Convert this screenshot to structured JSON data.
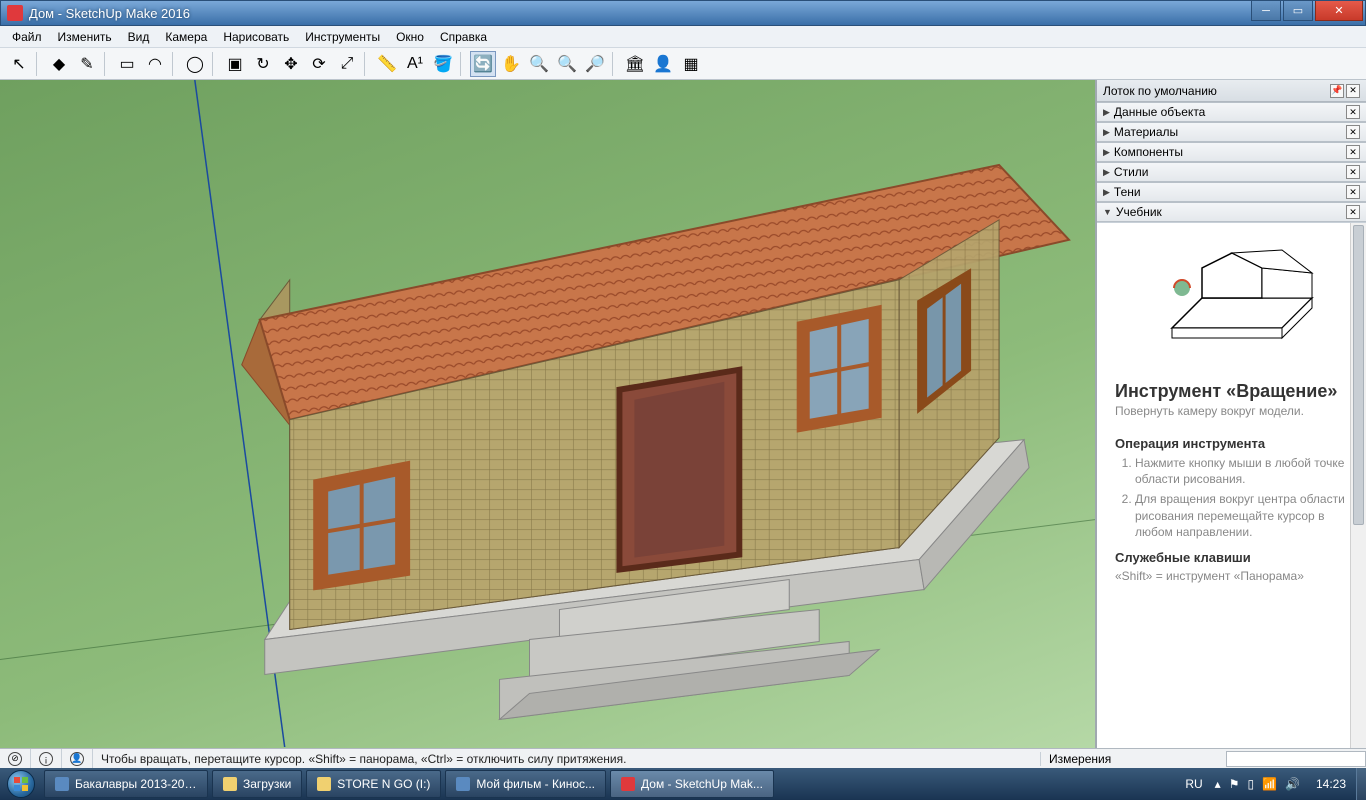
{
  "title": "Дом - SketchUp Make 2016",
  "menu": [
    "Файл",
    "Изменить",
    "Вид",
    "Камера",
    "Нарисовать",
    "Инструменты",
    "Окно",
    "Справка"
  ],
  "toolbar": [
    {
      "name": "select-tool",
      "glyph": "↖"
    },
    {
      "sep": true
    },
    {
      "name": "eraser-tool",
      "glyph": "◆"
    },
    {
      "name": "line-tool",
      "glyph": "✎"
    },
    {
      "sep": true
    },
    {
      "name": "rectangle-tool",
      "glyph": "▭"
    },
    {
      "name": "arc-tool",
      "glyph": "◠"
    },
    {
      "sep": true
    },
    {
      "name": "circle-tool",
      "glyph": "◯"
    },
    {
      "sep": true
    },
    {
      "name": "pushpull-tool",
      "glyph": "▣"
    },
    {
      "name": "followme-tool",
      "glyph": "↻"
    },
    {
      "name": "move-tool",
      "glyph": "✥"
    },
    {
      "name": "rotate-tool",
      "glyph": "⟳"
    },
    {
      "name": "scale-tool",
      "glyph": "⤢"
    },
    {
      "sep": true
    },
    {
      "name": "tape-tool",
      "glyph": "📏"
    },
    {
      "name": "text-tool",
      "glyph": "A¹"
    },
    {
      "name": "paint-tool",
      "glyph": "🪣"
    },
    {
      "sep": true
    },
    {
      "name": "orbit-tool",
      "glyph": "🔄",
      "active": true
    },
    {
      "name": "pan-tool",
      "glyph": "✋"
    },
    {
      "name": "zoom-tool",
      "glyph": "🔍"
    },
    {
      "name": "zoom-extents-tool",
      "glyph": "🔍"
    },
    {
      "name": "zoom-window-tool",
      "glyph": "🔎"
    },
    {
      "sep": true
    },
    {
      "name": "warehouse-tool",
      "glyph": "🏛"
    },
    {
      "name": "add-location-tool",
      "glyph": "👤"
    },
    {
      "name": "extensions-tool",
      "glyph": "▦"
    }
  ],
  "tray": {
    "title": "Лоток по умолчанию",
    "panels": [
      {
        "label": "Данные объекта",
        "open": false
      },
      {
        "label": "Материалы",
        "open": false
      },
      {
        "label": "Компоненты",
        "open": false
      },
      {
        "label": "Стили",
        "open": false
      },
      {
        "label": "Тени",
        "open": false
      },
      {
        "label": "Учебник",
        "open": true
      }
    ]
  },
  "instructor": {
    "title": "Инструмент «Вращение»",
    "subtitle": "Повернуть камеру вокруг модели.",
    "op_heading": "Операция инструмента",
    "steps": [
      "Нажмите кнопку мыши в любой точке области рисования.",
      "Для вращения вокруг центра области рисования перемещайте курсор в любом направлении."
    ],
    "keys_heading": "Служебные клавиши",
    "keys1": "«Shift» = инструмент «Панорама»"
  },
  "status": {
    "hint": "Чтобы вращать, перетащите курсор. «Shift» = панорама, «Ctrl» = отключить силу притяжения.",
    "measure_label": "Измерения"
  },
  "taskbar": {
    "items": [
      {
        "label": "Бакалавры 2013-201...",
        "icon": "blue"
      },
      {
        "label": "Загрузки",
        "icon": "folder"
      },
      {
        "label": "STORE N GO (I:)",
        "icon": "folder"
      },
      {
        "label": "Мой фильм - Кинос...",
        "icon": "blue"
      },
      {
        "label": "Дом - SketchUp Mak...",
        "icon": "red",
        "active": true
      }
    ],
    "lang": "RU",
    "time": "14:23"
  }
}
